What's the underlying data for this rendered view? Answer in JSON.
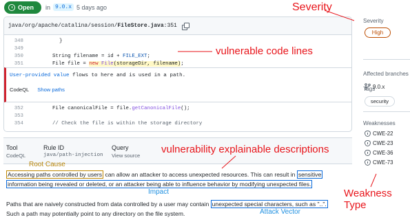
{
  "header": {
    "status": "Open",
    "in_text": "in",
    "branch": "9.0.x",
    "age": "5 days ago"
  },
  "code": {
    "file_path": "java/org/apache/catalina/session/",
    "file_name": "FileStore.java",
    "line_ref": ":351",
    "line_348_no": "348",
    "line_348": "}",
    "line_349_no": "349",
    "line_350_no": "350",
    "line_350_pre": "String filename = id + ",
    "line_350_const": "FILE_EXT",
    "line_350_post": ";",
    "line_351_no": "351",
    "line_351_pre": "File file = ",
    "line_351_new": "new",
    "line_351_fn": "File",
    "line_351_args": "(storageDir, filename)",
    "line_351_post": ";",
    "flow_a": "User-provided value",
    "flow_b": " flows to here and is used in a path.",
    "tab_codeql": "CodeQL",
    "tab_show_paths": "Show paths",
    "line_352_no": "352",
    "line_352_pre": "File canonicalFile = file.",
    "line_352_fn": "getCanonicalFile",
    "line_352_post": "();",
    "line_353_no": "353",
    "line_354_no": "354",
    "line_354": "// Check the file is within the storage directory"
  },
  "rule": {
    "tool_label": "Tool",
    "tool_value": "CodeQL",
    "rule_label": "Rule ID",
    "rule_value": "java/path-injection",
    "query_label": "Query",
    "query_value": "View source"
  },
  "description": {
    "p1_box1": "Accessing paths controlled by users",
    "p1_mid": " can allow an attacker to access unexpected resources. This can result in ",
    "p1_box2a": "sensitive",
    "p1_box2b": "information being revealed or deleted, or an attacker being able to influence behavior by modifying unexpected files.",
    "p2_pre": "Paths that are naively constructed from data controlled by a user may contain ",
    "p2_box": "unexpected special characters, such as \"..\".",
    "p2_line2": "Such a path may potentially point to any directory on the file system."
  },
  "sidebar": {
    "severity_label": "Severity",
    "severity_value": "High",
    "branches_label": "Affected branches",
    "branches_value": "9.0.x",
    "tags_label": "Tags",
    "tag": "security",
    "weaknesses_label": "Weaknesses",
    "cwes": [
      "CWE-22",
      "CWE-23",
      "CWE-36",
      "CWE-73"
    ]
  },
  "annotations": {
    "severity": "Severity",
    "vuln_lines": "vulnerable code lines",
    "explain": "vulnerability explainable descriptions",
    "root_cause": "Root Cause",
    "impact": "Impact",
    "attack_vector": "Attack Vector",
    "weakness_type": "Weakness Type"
  },
  "colors": {
    "annotation_red": "#e8151b",
    "open_green": "#1f883d",
    "severity_orange": "#bc4c00",
    "root_cause_box": "#bf8700",
    "impact_box": "#0969da"
  }
}
